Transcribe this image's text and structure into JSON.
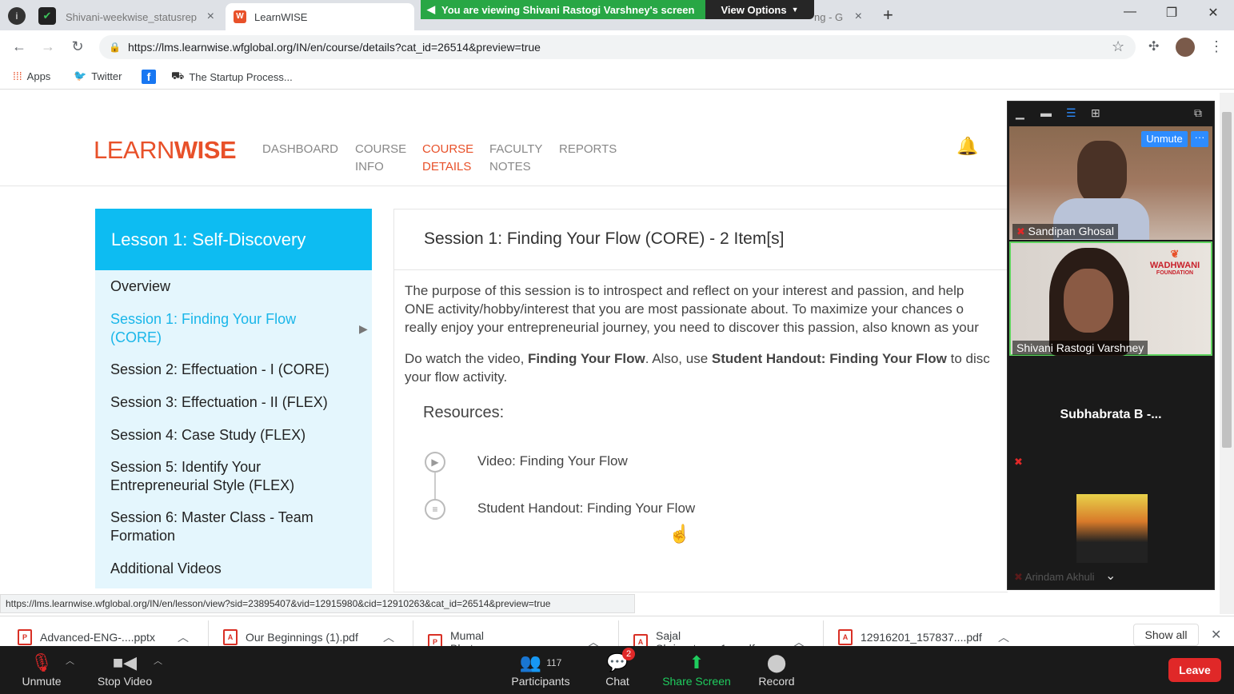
{
  "browser": {
    "tabs": [
      {
        "label": "Shivani-weekwise_statusrep",
        "active": false
      },
      {
        "label": "LearnWISE",
        "active": true
      },
      {
        "label": "ng - G",
        "active": false
      }
    ],
    "zoom_banner": "You are viewing Shivani Rastogi Varshney's screen",
    "view_options": "View Options",
    "url": "https://lms.learnwise.wfglobal.org/IN/en/course/details?cat_id=26514&preview=true",
    "bookmarks": [
      "Apps",
      "Twitter",
      "The Startup Process..."
    ]
  },
  "site": {
    "logo_light": "LEARN",
    "logo_bold": "WISE",
    "nav": [
      {
        "line1": "DASHBOARD",
        "line2": "",
        "active": false
      },
      {
        "line1": "COURSE",
        "line2": "INFO",
        "active": false
      },
      {
        "line1": "COURSE",
        "line2": "DETAILS",
        "active": true
      },
      {
        "line1": "FACULTY",
        "line2": "NOTES",
        "active": false
      },
      {
        "line1": "REPORTS",
        "line2": "",
        "active": false
      }
    ]
  },
  "sidebar": {
    "title": "Lesson 1: Self-Discovery",
    "items": [
      {
        "label": "Overview",
        "active": false
      },
      {
        "label": "Session 1: Finding Your Flow (CORE)",
        "active": true
      },
      {
        "label": "Session 2: Effectuation - I (CORE)",
        "active": false
      },
      {
        "label": "Session 3: Effectuation - II (FLEX)",
        "active": false
      },
      {
        "label": "Session 4: Case Study (FLEX)",
        "active": false
      },
      {
        "label": "Session 5: Identify Your Entrepreneurial Style (FLEX)",
        "active": false
      },
      {
        "label": "Session 6: Master Class - Team Formation",
        "active": false
      },
      {
        "label": "Additional Videos",
        "active": false
      }
    ]
  },
  "main": {
    "session_title": "Session 1: Finding Your Flow (CORE) - 2 Item[s]",
    "para1_line1": "The purpose of this session is to introspect and reflect on your interest and passion, and help",
    "para1_line2": "ONE activity/hobby/interest that you are most passionate about. To maximize your chances o",
    "para1_line3": "really enjoy your entrepreneurial journey, you need to discover this passion, also known as your",
    "para2_a": "Do watch the video, ",
    "para2_b": "Finding Your Flow",
    "para2_c": ". Also, use ",
    "para2_d": "Student Handout: Finding Your Flow",
    "para2_e": " to disc",
    "para2_line2": "your flow activity.",
    "resources_label": "Resources:",
    "resources": [
      {
        "label": "Video: Finding Your Flow",
        "icon": "play-icon"
      },
      {
        "label": "Student Handout: Finding Your Flow",
        "icon": "document-icon"
      }
    ]
  },
  "status_url": "https://lms.learnwise.wfglobal.org/IN/en/lesson/view?sid=23895407&vid=12915980&cid=12910263&cat_id=26514&preview=true",
  "downloads": {
    "items": [
      "Advanced-ENG-....pptx",
      "Our Beginnings (1).pdf",
      "Mumal Bhatnagar....pp...",
      "Sajal Shrivastava_1....pdf",
      "12916201_157837....pdf"
    ],
    "show_all": "Show all"
  },
  "zoom": {
    "unmute": "Unmute",
    "stop_video": "Stop Video",
    "participants": "Participants",
    "participants_count": "117",
    "chat": "Chat",
    "chat_badge": "2",
    "share_screen": "Share Screen",
    "record": "Record",
    "leave": "Leave",
    "tile_unmute": "Unmute",
    "tile_more": "···",
    "participants_list": [
      {
        "name": "Sandipan Ghosal"
      },
      {
        "name": "Shivani Rastogi Varshney"
      },
      {
        "name": "Subhabrata B -..."
      },
      {
        "name": "Arindam Akhuli"
      }
    ],
    "wadhwani_logo": "WADHWANI",
    "wadhwani_sub": "FOUNDATION"
  }
}
